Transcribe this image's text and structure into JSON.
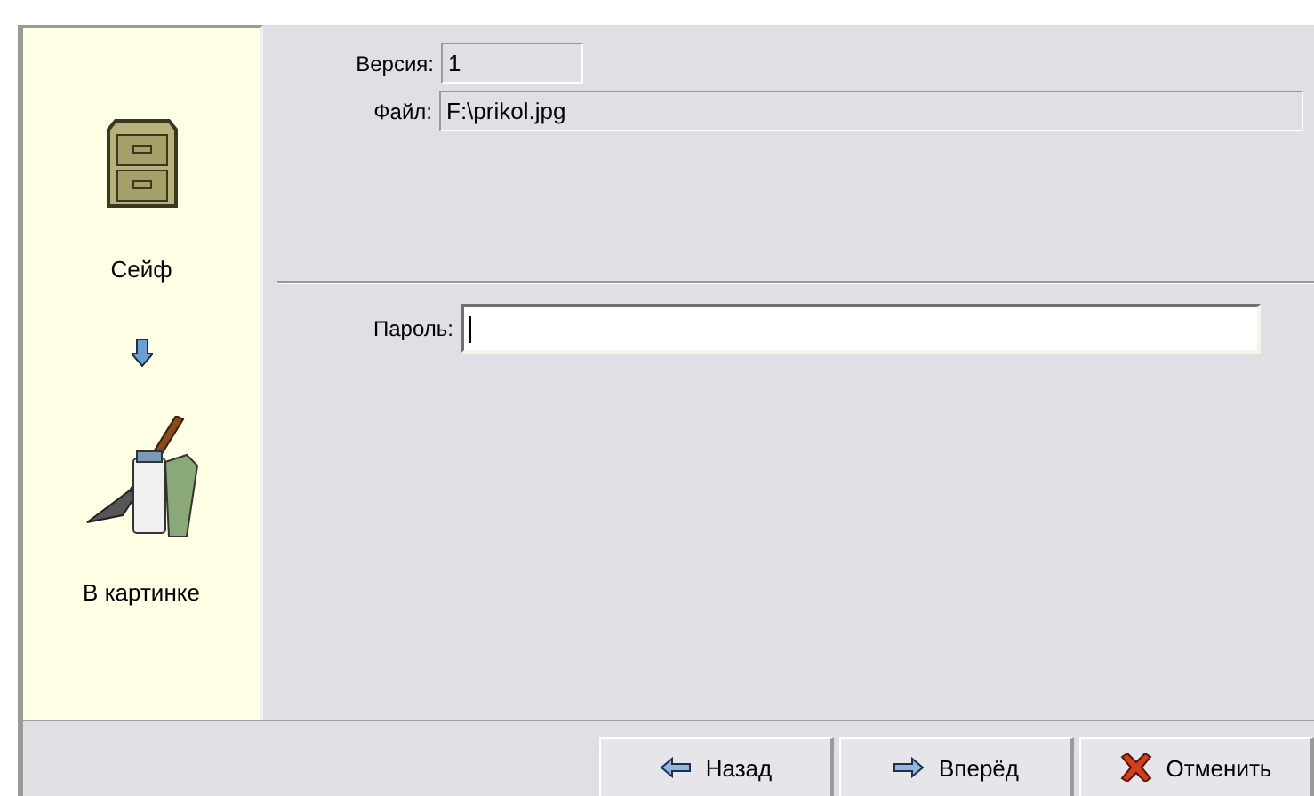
{
  "sidebar": {
    "steps": [
      {
        "kind": "cabinet",
        "label": "Сейф"
      },
      {
        "kind": "arrow"
      },
      {
        "kind": "paint",
        "label": "В картинке"
      }
    ]
  },
  "fields": [
    {
      "label": "Версия:",
      "value": "1",
      "wide": false
    },
    {
      "label": "Файл:",
      "value": "F:\\prikol.jpg",
      "wide": true
    }
  ],
  "password": {
    "label": "Пароль:"
  },
  "buttons": [
    {
      "kind": "back",
      "label": "Назад"
    },
    {
      "kind": "next",
      "label": "Вперёд"
    },
    {
      "kind": "cancel",
      "label": "Отменить"
    }
  ]
}
